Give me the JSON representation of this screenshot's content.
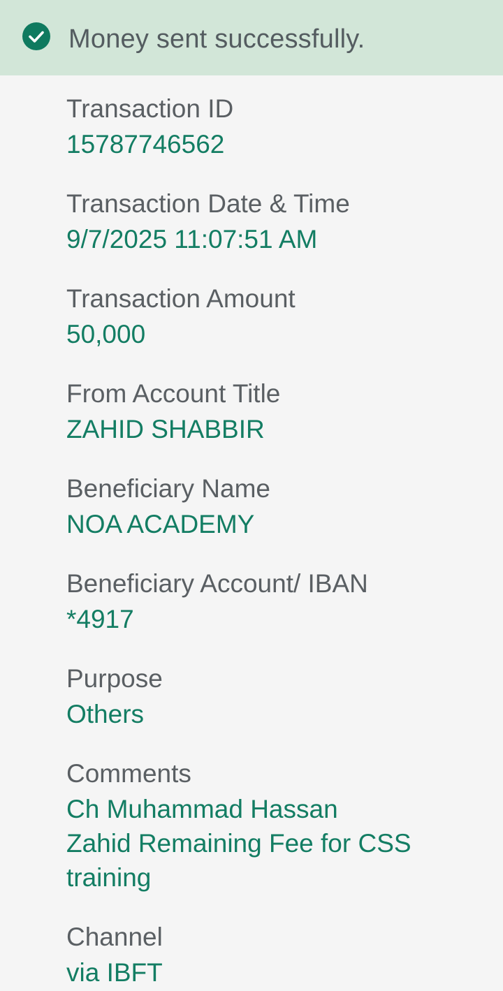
{
  "banner": {
    "icon": "check-circle-icon",
    "message": "Money sent successfully.",
    "background": "#d2e6d8",
    "accent": "#0f7a5f"
  },
  "details": {
    "transaction_id": {
      "label": "Transaction ID",
      "value": "15787746562"
    },
    "date_time": {
      "label": "Transaction Date & Time",
      "value": "9/7/2025 11:07:51 AM"
    },
    "amount": {
      "label": "Transaction Amount",
      "value": "50,000"
    },
    "from_account_title": {
      "label": "From Account Title",
      "value": "ZAHID SHABBIR"
    },
    "beneficiary_name": {
      "label": "Beneficiary Name",
      "value": "NOA ACADEMY"
    },
    "beneficiary_account": {
      "label": "Beneficiary Account/ IBAN",
      "value": "*4917"
    },
    "purpose": {
      "label": "Purpose",
      "value": "Others"
    },
    "comments": {
      "label": "Comments",
      "value": "Ch Muhammad Hassan\nZahid Remaining Fee for CSS\ntraining"
    },
    "channel": {
      "label": "Channel",
      "value": "via IBFT"
    }
  },
  "colors": {
    "label_text": "#5a5f63",
    "value_text": "#137d63",
    "page_background": "#f5f5f5"
  }
}
